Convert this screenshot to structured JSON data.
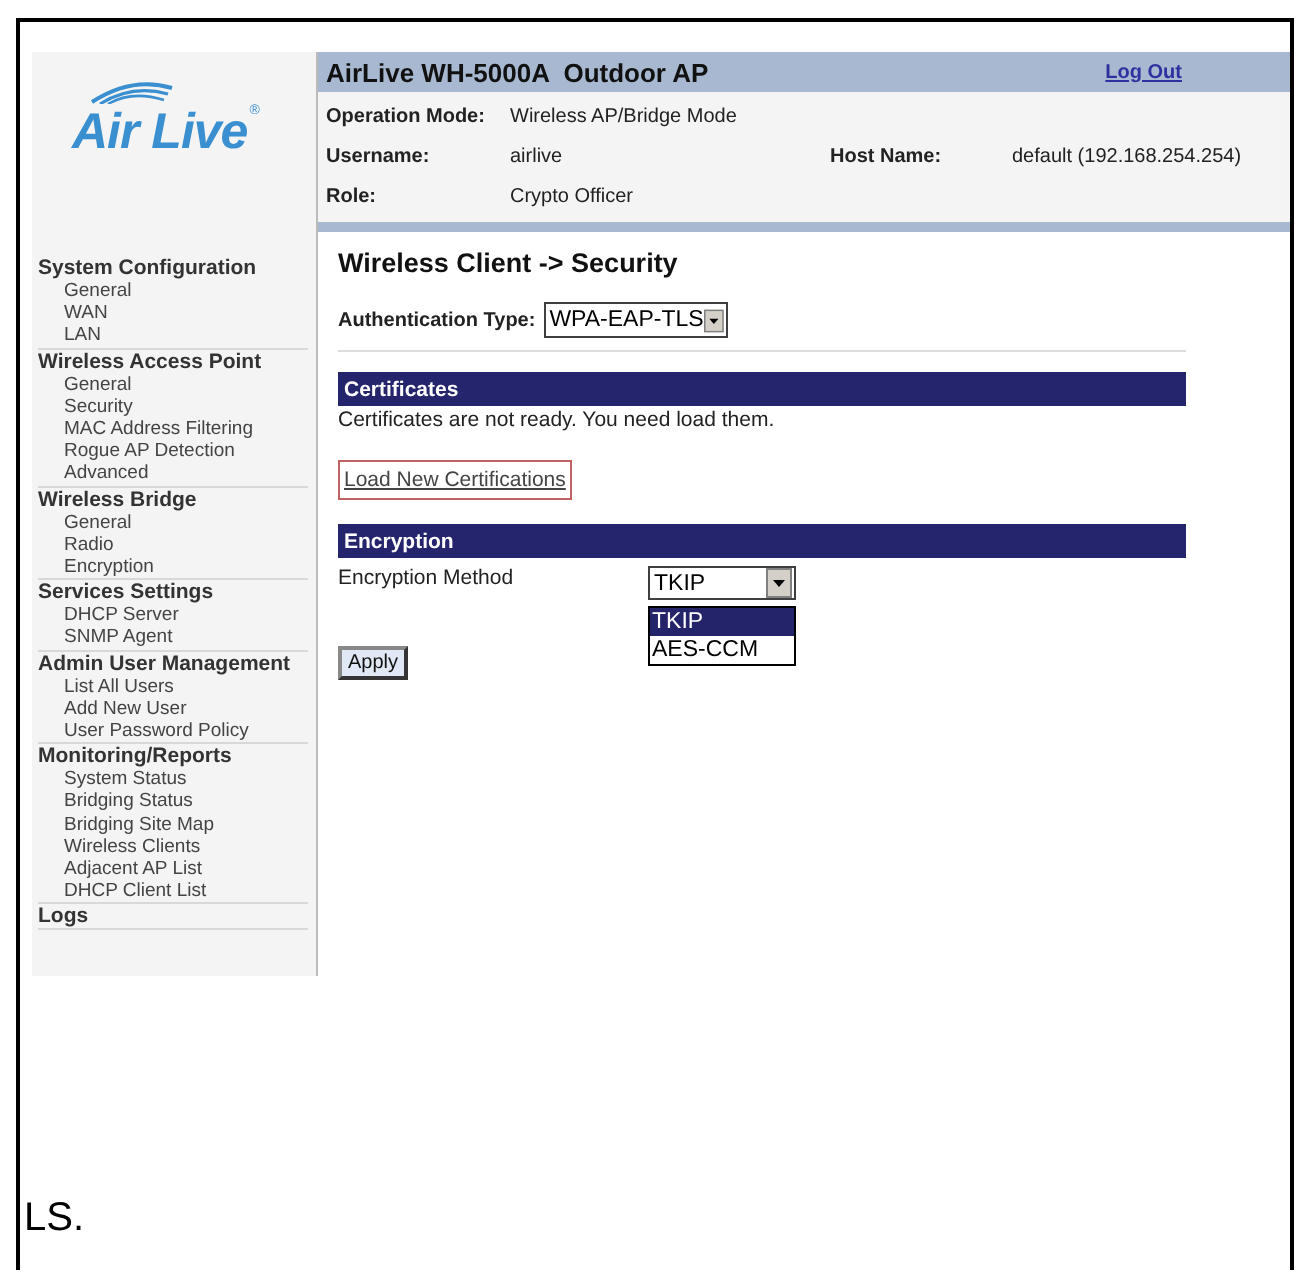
{
  "logo": {
    "text": "Air Live",
    "mark": "®"
  },
  "header": {
    "title": "AirLive WH-5000A  Outdoor AP",
    "logout": "Log Out"
  },
  "info": [
    {
      "label": "Operation Mode:",
      "value": "Wireless AP/Bridge Mode"
    },
    {
      "label": "Username:",
      "value": "airlive"
    },
    {
      "label": "Role:",
      "value": "Crypto Officer"
    }
  ],
  "host": {
    "label": "Host Name:",
    "value": "default (192.168.254.254)"
  },
  "sidebar": {
    "sections": [
      {
        "title": "System Configuration",
        "children": [
          "General",
          "WAN",
          "LAN"
        ]
      },
      {
        "title": "Wireless Access Point",
        "children": [
          "General",
          "Security",
          "MAC Address Filtering",
          "Rogue AP Detection",
          "Advanced"
        ]
      },
      {
        "title": "Wireless Bridge",
        "children": [
          "General",
          "Radio",
          "Encryption"
        ]
      },
      {
        "title": "Services Settings",
        "children": [
          "DHCP Server",
          "SNMP Agent"
        ]
      },
      {
        "title": "Admin User Management",
        "children": [
          "List All Users",
          "Add New User",
          "User Password Policy"
        ]
      },
      {
        "title": "Monitoring/Reports",
        "children": [
          "System Status",
          "Bridging Status",
          "Bridging Site Map",
          "Wireless Clients",
          "Adjacent AP List",
          "DHCP Client List"
        ]
      },
      {
        "title": "Logs"
      }
    ]
  },
  "page_title": "Wireless Client -> Security",
  "auth": {
    "label": "Authentication Type:",
    "value": "WPA-EAP-TLS"
  },
  "certificates": {
    "heading": "Certificates",
    "message": "Certificates are not ready. You need load them.",
    "link": "Load New Certifications"
  },
  "encryption": {
    "heading": "Encryption",
    "label": "Encryption Method",
    "value": "TKIP",
    "expanded": true,
    "options": [
      {
        "label": "TKIP",
        "selected": true
      },
      {
        "label": "AES-CCM",
        "selected": false
      }
    ]
  },
  "apply": "Apply",
  "caption": "LS."
}
